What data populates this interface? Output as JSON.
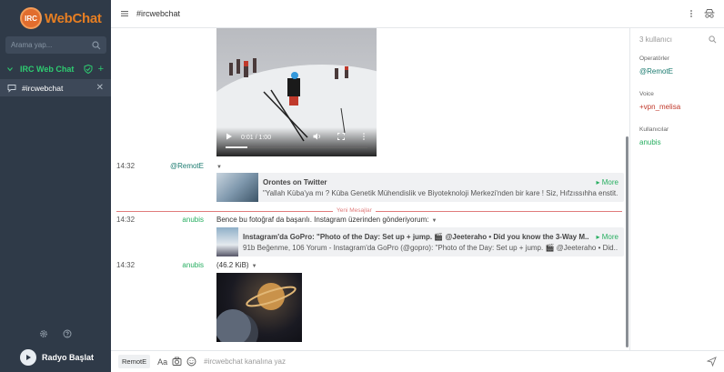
{
  "app": {
    "logo_badge": "IRC",
    "logo_text": "WebChat"
  },
  "sidebar": {
    "search_placeholder": "Arama yap...",
    "network_label": "IRC Web Chat",
    "channel_label": "#ircwebchat",
    "radio_label": "Radyo Başlat"
  },
  "header": {
    "channel": "#ircwebchat"
  },
  "video": {
    "time": "0:01 / 1:00"
  },
  "messages": [
    {
      "time": "14:32",
      "nick": "@RemotE",
      "nick_color": "#1a7a6f"
    },
    {
      "time": "14:32",
      "nick": "anubis",
      "nick_color": "#27ae60",
      "text": "Bence bu fotoğraf da başarılı. Instagram üzerinden gönderiyorum:"
    },
    {
      "time": "14:32",
      "nick": "anubis",
      "nick_color": "#27ae60",
      "text": "(46.2 KiB)"
    }
  ],
  "previews": [
    {
      "title": "Orontes on Twitter",
      "desc": "\"Yallah Küba'ya mı ? Küba Genetik Mühendislik ve Biyoteknoloji Merkezi'nden bir kare ! Siz, Hıfzıssıhha enstit...",
      "more": "More"
    },
    {
      "title": "Instagram'da GoPro: \"Photo of the Day: Set up + jump. 🎬 @Jeeteraho • Did you know the 3-Way M...",
      "desc": "91b Beğenme, 106 Yorum - Instagram'da GoPro (@gopro): \"Photo of the Day: Set up + jump. 🎬 @Jeeteraho • Did...",
      "more": "More"
    }
  ],
  "divider_label": "Yeni Mesajlar",
  "userlist": {
    "count": "3 kullanıcı",
    "groups": [
      {
        "title": "Operatörler",
        "user": "@RemotE",
        "color": "#1a7a6f"
      },
      {
        "title": "Voice",
        "user": "+vpn_melisa",
        "color": "#c0392b"
      },
      {
        "title": "Kullanıcılar",
        "user": "anubis",
        "color": "#27ae60"
      }
    ]
  },
  "input": {
    "nick": "RemotE",
    "aa": "Aa",
    "placeholder": "#ircwebchat kanalına yaz"
  },
  "colors": {
    "accent_green": "#2ecc71",
    "sidebar_bg": "#2f3a48",
    "divider_red": "#e07b7b"
  }
}
